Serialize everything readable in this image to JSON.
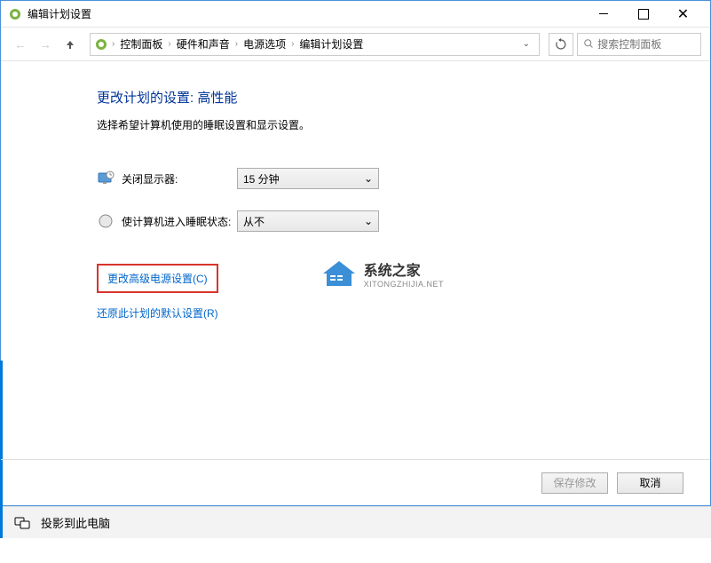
{
  "window": {
    "title": "编辑计划设置"
  },
  "breadcrumb": {
    "items": [
      "控制面板",
      "硬件和声音",
      "电源选项",
      "编辑计划设置"
    ]
  },
  "search": {
    "placeholder": "搜索控制面板"
  },
  "page": {
    "title": "更改计划的设置: 高性能",
    "subtitle": "选择希望计算机使用的睡眠设置和显示设置。"
  },
  "settings": {
    "display": {
      "label": "关闭显示器:",
      "value": "15 分钟"
    },
    "sleep": {
      "label": "使计算机进入睡眠状态:",
      "value": "从不"
    }
  },
  "links": {
    "advanced": "更改高级电源设置(C)",
    "restore": "还原此计划的默认设置(R)"
  },
  "watermark": {
    "title": "系统之家",
    "url": "XITONGZHIJIA.NET"
  },
  "footer": {
    "save": "保存修改",
    "cancel": "取消"
  },
  "taskbar": {
    "label": "投影到此电脑"
  }
}
